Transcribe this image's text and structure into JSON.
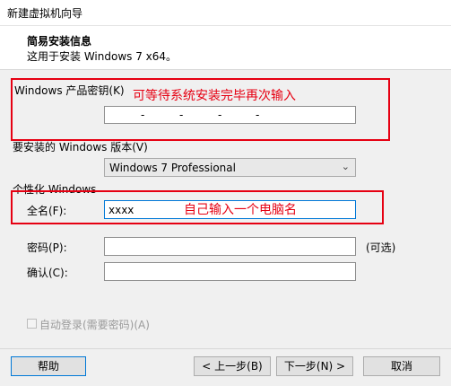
{
  "window": {
    "title": "新建虚拟机向导"
  },
  "header": {
    "title": "简易安装信息",
    "subtitle": "这用于安装 Windows 7 x64。"
  },
  "product_key": {
    "label": "Windows 产品密钥(K)",
    "separator": "-",
    "value": ""
  },
  "version": {
    "label": "要安装的 Windows 版本(V)",
    "selected": "Windows 7 Professional"
  },
  "personalize": {
    "label": "个性化 Windows"
  },
  "full_name": {
    "label": "全名(F):",
    "value": "xxxx"
  },
  "password": {
    "label": "密码(P):",
    "value": "",
    "optional_note": "(可选)"
  },
  "confirm": {
    "label": "确认(C):",
    "value": ""
  },
  "auto_login": {
    "label": "自动登录(需要密码)(A)",
    "checked": false
  },
  "annotations": {
    "key_note": "可等待系统安装完毕再次输入",
    "name_note": "自己输入一个电脑名",
    "color": "#e60012"
  },
  "buttons": {
    "help": "帮助",
    "back": "< 上一步(B)",
    "next": "下一步(N) >",
    "cancel": "取消"
  },
  "icons": {
    "dropdown": "chevron-down-icon"
  }
}
